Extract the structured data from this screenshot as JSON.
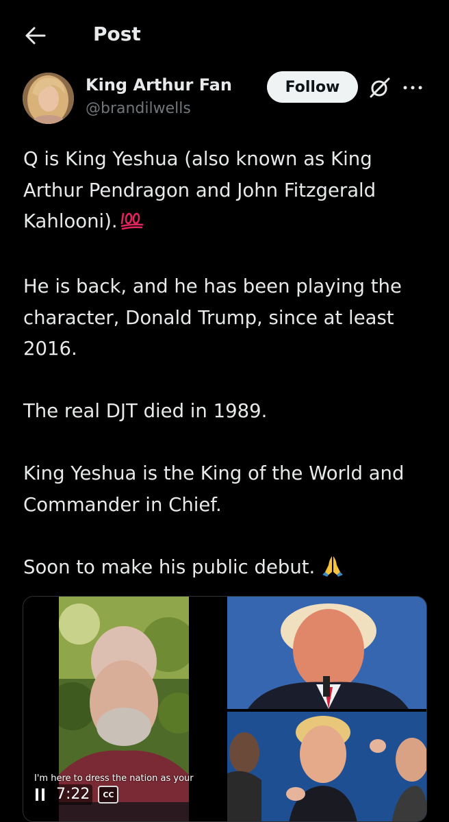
{
  "header": {
    "title": "Post",
    "back_icon": "arrow-left-icon"
  },
  "author": {
    "display_name": "King Arthur Fan",
    "handle": "@brandilwells",
    "follow_label": "Follow",
    "grok_icon": "grok-icon",
    "more_icon": "more-horizontal-icon"
  },
  "post": {
    "paragraphs": [
      "Q is King Yeshua (also known as King Arthur Pendragon and John Fitzgerald Kahlooni).",
      "He is back, and he has been playing the character, Donald Trump, since at least 2016.",
      "The real DJT died in 1989.",
      "King Yeshua is the King of the World and Commander in Chief.",
      "Soon to make his public debut."
    ],
    "emoji_1": "hundred-points-emoji",
    "emoji_2": "folded-hands-emoji"
  },
  "media": {
    "video": {
      "caption": "I'm here to dress the nation as your",
      "time": "7:22",
      "cc_label": "CC",
      "pause_icon": "pause-icon"
    }
  },
  "colors": {
    "background": "#000000",
    "text": "#e7e9ea",
    "secondary_text": "#71767b",
    "follow_bg": "#eff3f4",
    "border": "#2f3336"
  }
}
